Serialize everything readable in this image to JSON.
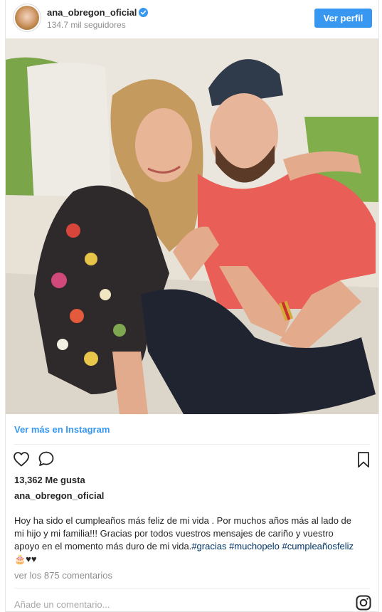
{
  "post": {
    "username": "ana_obregon_oficial",
    "followers": "134.7 mil seguidores",
    "view_profile_label": "Ver perfil",
    "view_more_label": "Ver más en Instagram",
    "likes": "13,362 Me gusta",
    "caption_author": "ana_obregon_oficial",
    "caption_line1": "Hoy ha sido el cumpleaños más feliz de mi vida . Por muchos años más al lado de",
    "caption_line2": "mi hijo y mi familia!!! Gracias por todos vuestros mensajes de cariño y vuestro",
    "caption_line3_text": "apoyo en el momento más duro de mi vida.",
    "hashtags": [
      "#gracias",
      "#muchopelo",
      "#cumpleañosfeliz"
    ],
    "caption_line4": "🎂♥♥",
    "comments_link": "ver los 875 comentarios",
    "add_comment_placeholder": "Añade un comentario..."
  },
  "icons": {
    "verified": "verified-badge-icon",
    "like": "heart-icon",
    "comment": "comment-bubble-icon",
    "save": "bookmark-icon",
    "instagram": "instagram-logo-icon"
  },
  "colors": {
    "accent": "#3897f0",
    "hashtag": "#003569",
    "muted": "#8e8e8e"
  }
}
